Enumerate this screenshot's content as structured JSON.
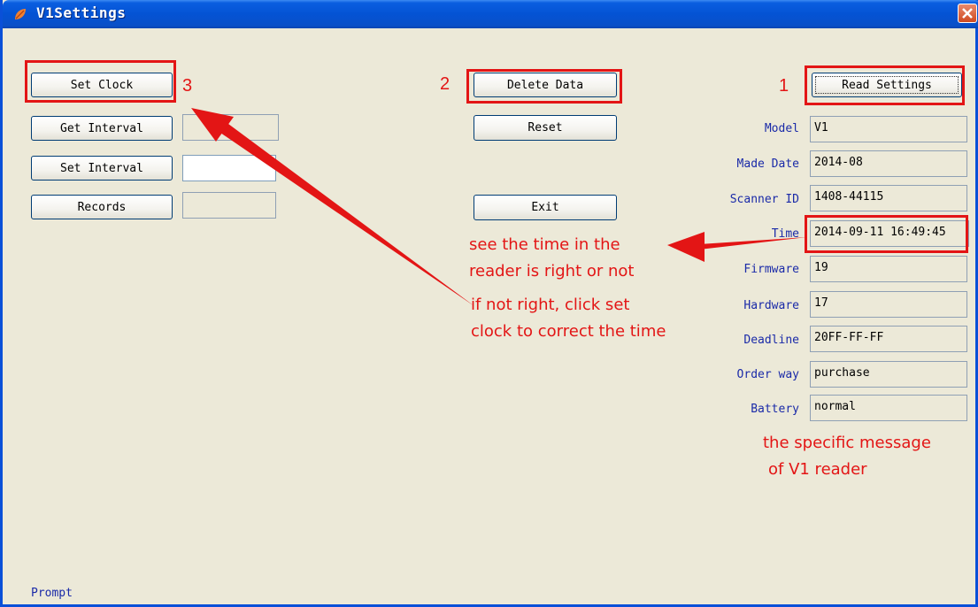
{
  "window": {
    "title": "V1Settings",
    "prompt": "Prompt"
  },
  "buttons": {
    "set_clock": "Set Clock",
    "get_interval": "Get Interval",
    "set_interval": "Set Interval",
    "records": "Records",
    "delete_data": "Delete Data",
    "reset": "Reset",
    "exit": "Exit",
    "read_settings": "Read Settings"
  },
  "fields": [
    {
      "label": "Model",
      "value": "V1"
    },
    {
      "label": "Made Date",
      "value": "2014-08"
    },
    {
      "label": "Scanner ID",
      "value": "1408-44115"
    },
    {
      "label": "Time",
      "value": "2014-09-11 16:49:45"
    },
    {
      "label": "Firmware",
      "value": "19"
    },
    {
      "label": "Hardware",
      "value": "17"
    },
    {
      "label": "Deadline",
      "value": "20FF-FF-FF"
    },
    {
      "label": "Order way",
      "value": "purchase"
    },
    {
      "label": "Battery",
      "value": "normal"
    }
  ],
  "annotations": {
    "step1": "1",
    "step2": "2",
    "step3": "3",
    "time_note_1": "see the time in the",
    "time_note_2": "reader is right or not",
    "clock_note_1": "if not right, click set",
    "clock_note_2": "clock to correct the time",
    "message_note_1": "the specific message",
    "message_note_2": "of V1 reader",
    "color": "#e31515"
  }
}
